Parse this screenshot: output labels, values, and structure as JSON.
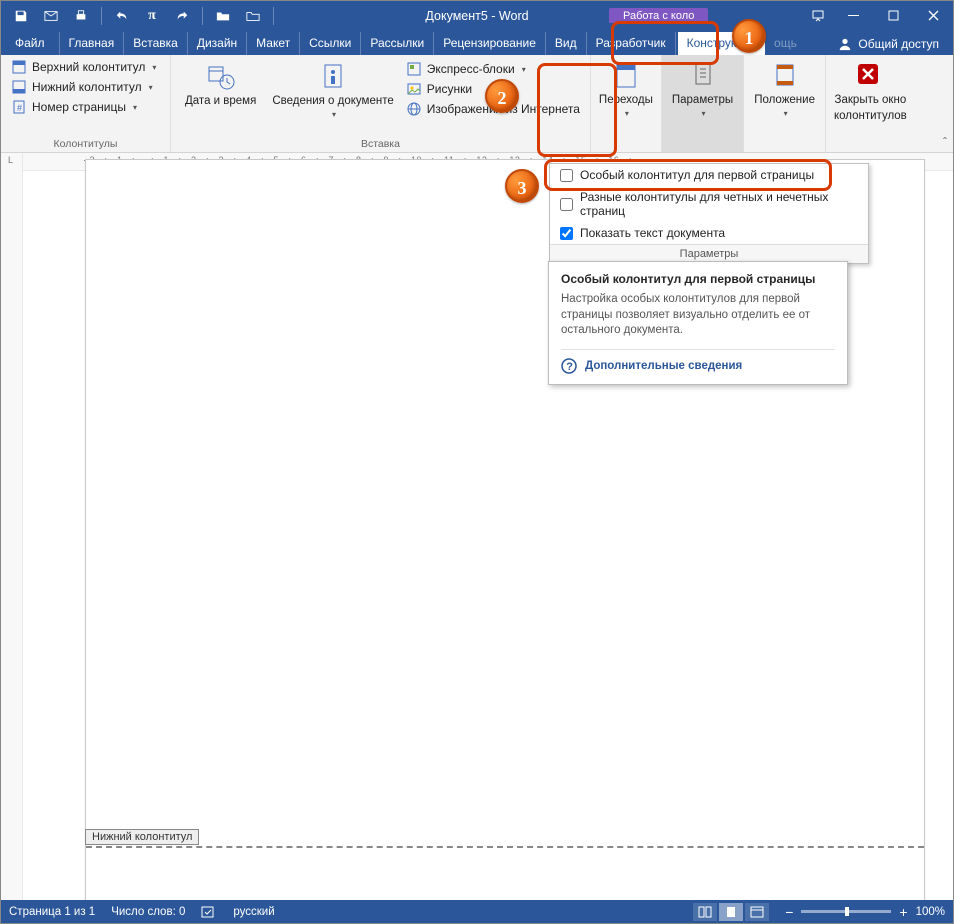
{
  "title": "Документ5 - Word",
  "contextual_label": "Работа с коло",
  "tabs": {
    "file": "Файл",
    "home": "Главная",
    "insert": "Вставка",
    "design": "Дизайн",
    "layout": "Макет",
    "references": "Ссылки",
    "mailings": "Рассылки",
    "review": "Рецензирование",
    "view": "Вид",
    "developer": "Разработчик",
    "konstruktor": "Конструктор",
    "help_hint": "ощь"
  },
  "share": "Общий доступ",
  "ribbon": {
    "group1": {
      "header": "Верхний колонтитул",
      "footer": "Нижний колонтитул",
      "page_number": "Номер страницы",
      "label": "Колонтитулы"
    },
    "group2": {
      "date": "Дата и время",
      "docinfo": "Сведения о документе",
      "label": "Вставка",
      "quick": "Экспресс-блоки",
      "pics": "Рисунки",
      "webpics": "Изображения из Интернета"
    },
    "nav": {
      "goto": "Переходы"
    },
    "params": {
      "label": "Параметры"
    },
    "position": {
      "label": "Положение"
    },
    "close": {
      "l1": "Закрыть окно",
      "l2": "колонтитулов"
    }
  },
  "ruler_text": "· 2 · ı · 1 · ı ·   · ı · 1 · ı · 2 · ı · 3 · ı · 4 · ı · 5 · ı · 6 · ı · 7 · ı · 8 · ı · 9 · ı · 10 · ı · 11 · ı · 12 · ı · 13 · ı · 14 · ı · 15 · ı · 16 · ı",
  "vtick": "L",
  "params_dropdown": {
    "opt1": "Особый колонтитул для первой страницы",
    "opt2": "Разные колонтитулы для четных и нечетных страниц",
    "opt3": "Показать текст документа",
    "footer": "Параметры"
  },
  "tooltip": {
    "title": "Особый колонтитул для первой страницы",
    "body": "Настройка особых колонтитулов для первой страницы позволяет визуально отделить ее от остального документа.",
    "more": "Дополнительные сведения"
  },
  "footer_tag": "Нижний колонтитул",
  "status": {
    "page": "Страница 1 из 1",
    "words": "Число слов: 0",
    "lang": "русский",
    "zoom": "100%"
  },
  "callouts": {
    "c1": "1",
    "c2": "2",
    "c3": "3"
  },
  "checked": {
    "opt3": true
  }
}
